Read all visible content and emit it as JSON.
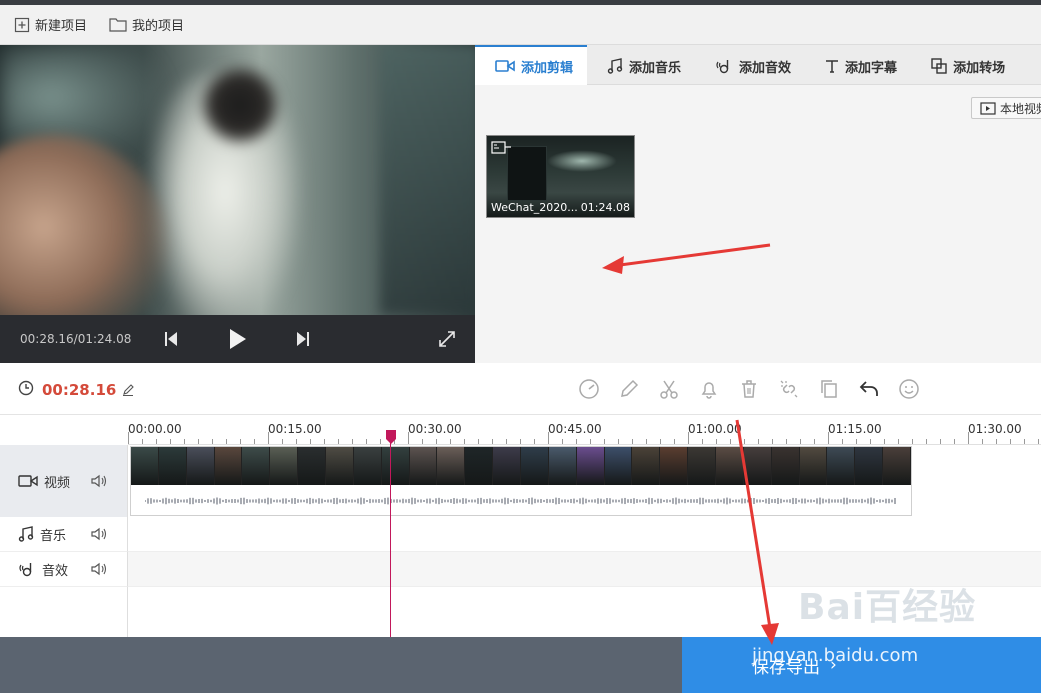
{
  "menubar": {
    "new_project": "新建项目",
    "my_projects": "我的项目"
  },
  "player": {
    "time": "00:28.16/01:24.08",
    "icons": [
      "prev-frame-icon",
      "play-icon",
      "next-frame-icon",
      "fullscreen-icon"
    ]
  },
  "tabs": [
    {
      "label": "添加剪辑",
      "icon": "video-camera-icon",
      "active": true
    },
    {
      "label": "添加音乐",
      "icon": "music-note-icon",
      "active": false
    },
    {
      "label": "添加音效",
      "icon": "sound-effect-icon",
      "active": false
    },
    {
      "label": "添加字幕",
      "icon": "text-icon",
      "active": false
    },
    {
      "label": "添加转场",
      "icon": "transition-icon",
      "active": false
    }
  ],
  "media": {
    "local_video_label": "本地视频",
    "clip": {
      "name": "WeChat_2020...",
      "duration": "01:24.08"
    }
  },
  "toolbar": {
    "current_time": "00:28.16",
    "tools": [
      "speed-icon",
      "pencil-icon",
      "scissors-icon",
      "bell-icon",
      "trash-icon",
      "unlink-icon",
      "copy-icon",
      "undo-icon",
      "emoji-icon"
    ]
  },
  "timeline": {
    "ticks": [
      "00:00.00",
      "00:15.00",
      "00:30.00",
      "00:45.00",
      "01:00.00",
      "01:15.00",
      "01:30.00"
    ],
    "playhead": "00:28.16",
    "tracks": [
      {
        "label": "视频",
        "icon": "video-camera-icon"
      },
      {
        "label": "音乐",
        "icon": "music-note-icon"
      },
      {
        "label": "音效",
        "icon": "sound-effect-icon"
      }
    ]
  },
  "footer": {
    "export_label": "保存导出",
    "watermark": "jingyan.baidu.com",
    "logo_text": "Bai百经验"
  },
  "colors": {
    "accent": "#2a7fd0",
    "time_red": "#d44a3a",
    "playhead": "#c2185b",
    "export_blue": "#2f8de6",
    "annotation_red": "#e53935"
  }
}
